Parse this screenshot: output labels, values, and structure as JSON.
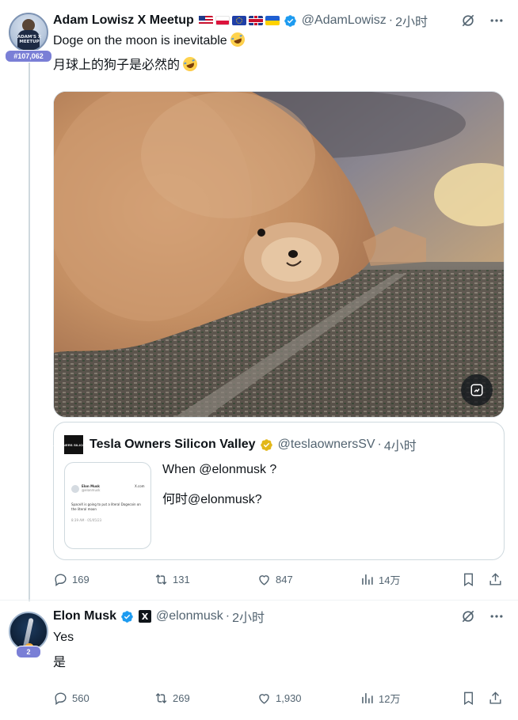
{
  "tweets": [
    {
      "display_name": "Adam Lowisz X Meetup",
      "flags": [
        "flag-us",
        "flag-pl",
        "flag-eu",
        "flag-uk",
        "flag-ua"
      ],
      "handle": "@AdamLowisz",
      "separator": "·",
      "time": "2小时",
      "avatar_text": "ADAM'S X MEETUP",
      "badge": "#107,062",
      "text_lines": [
        "Doge on the moon is inevitable",
        "月球上的狗子是必然的"
      ],
      "quote": {
        "avatar_text": "TESLA OWNERS SILICON VALLEY",
        "display_name": "Tesla Owners Silicon Valley",
        "handle": "@teslaownersSV",
        "separator": "·",
        "time": "4小时",
        "text_lines": [
          "When @elonmusk ?",
          "何时@elonmusk?"
        ],
        "thumb": {
          "name": "Elon Musk",
          "site": "X.com",
          "handle": "@elonmusk",
          "body": [
            "SpaceX is going to put a literal Dogecoin on",
            "the literal moon"
          ],
          "timestamp": "8:39 AM · 05/05/23"
        }
      },
      "actions": {
        "replies": "169",
        "retweets": "131",
        "likes": "847",
        "views": "14万"
      }
    },
    {
      "display_name": "Elon Musk",
      "handle": "@elonmusk",
      "separator": "·",
      "time": "2小时",
      "badge": "2",
      "text_lines": [
        "Yes",
        "是"
      ],
      "actions": {
        "replies": "560",
        "retweets": "269",
        "likes": "1,930",
        "views": "12万"
      }
    }
  ],
  "colors": {
    "verified_blue": "#1d9bf0",
    "verified_gold": "#e2b719",
    "muted_text": "#536471",
    "thread_line": "#cfd9de"
  },
  "icons": {
    "grok": "grok-icon",
    "more": "more-icon",
    "reply": "reply-icon",
    "retweet": "retweet-icon",
    "like": "heart-icon",
    "views": "views-icon",
    "bookmark": "bookmark-icon",
    "share": "share-icon",
    "alt": "alt-edit-icon"
  }
}
